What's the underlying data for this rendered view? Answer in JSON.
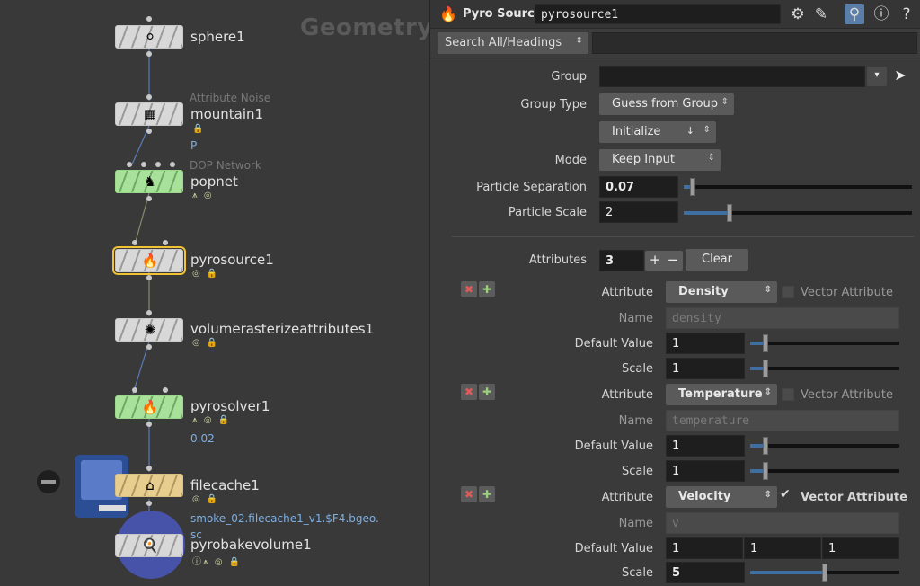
{
  "network": {
    "title": "Geometry",
    "nodes": [
      {
        "name": "sphere1",
        "type_label": "",
        "extra": ""
      },
      {
        "name": "mountain1",
        "type_label": "Attribute Noise",
        "extra": "P"
      },
      {
        "name": "popnet",
        "type_label": "DOP Network",
        "extra": ""
      },
      {
        "name": "pyrosource1",
        "type_label": "",
        "extra": ""
      },
      {
        "name": "volumerasterizeattributes1",
        "type_label": "",
        "extra": ""
      },
      {
        "name": "pyrosolver1",
        "type_label": "",
        "extra": "0.02"
      },
      {
        "name": "filecache1",
        "type_label": "",
        "extra": "smoke_02.filecache1_v1.$F4.bgeo.",
        "extra2": "sc"
      },
      {
        "name": "pyrobakevolume1",
        "type_label": "",
        "extra": ""
      }
    ]
  },
  "header": {
    "node_type": "Pyro Source",
    "node_name": "pyrosource1",
    "icons": [
      "gear-icon",
      "brush-icon",
      "search-icon",
      "info-icon",
      "help-icon"
    ]
  },
  "search": {
    "label": "Search All/Headings"
  },
  "params": {
    "group": {
      "label": "Group",
      "value": ""
    },
    "group_type": {
      "label": "Group Type",
      "value": "Guess from Group"
    },
    "initialize": {
      "value": "Initialize"
    },
    "mode": {
      "label": "Mode",
      "value": "Keep Input"
    },
    "particle_separation": {
      "label": "Particle Separation",
      "value": "0.07",
      "slider": 0.04
    },
    "particle_scale": {
      "label": "Particle Scale",
      "value": "2",
      "slider": 0.2
    },
    "attributes": {
      "label": "Attributes",
      "value": "3",
      "clear_label": "Clear"
    },
    "attribute_items": [
      {
        "attribute_label": "Attribute",
        "attribute_value": "Density",
        "vector_label": "Vector Attribute",
        "vector_checked": false,
        "name_label": "Name",
        "name_value": "density",
        "default_label": "Default Value",
        "default_values": [
          "1"
        ],
        "default_slider": 0.1,
        "scale_label": "Scale",
        "scale_value": "1",
        "scale_slider": 0.1
      },
      {
        "attribute_label": "Attribute",
        "attribute_value": "Temperature",
        "vector_label": "Vector Attribute",
        "vector_checked": false,
        "name_label": "Name",
        "name_value": "temperature",
        "default_label": "Default Value",
        "default_values": [
          "1"
        ],
        "default_slider": 0.1,
        "scale_label": "Scale",
        "scale_value": "1",
        "scale_slider": 0.1
      },
      {
        "attribute_label": "Attribute",
        "attribute_value": "Velocity",
        "vector_label": "Vector Attribute",
        "vector_checked": true,
        "name_label": "Name",
        "name_value": "v",
        "default_label": "Default Value",
        "default_values": [
          "1",
          "1",
          "1"
        ],
        "scale_label": "Scale",
        "scale_value": "5",
        "scale_slider": 0.5
      }
    ]
  },
  "colors": {
    "accent": "#f1c232",
    "slider_fill": "#3f6ea0",
    "selection": "#5b7ea8"
  }
}
